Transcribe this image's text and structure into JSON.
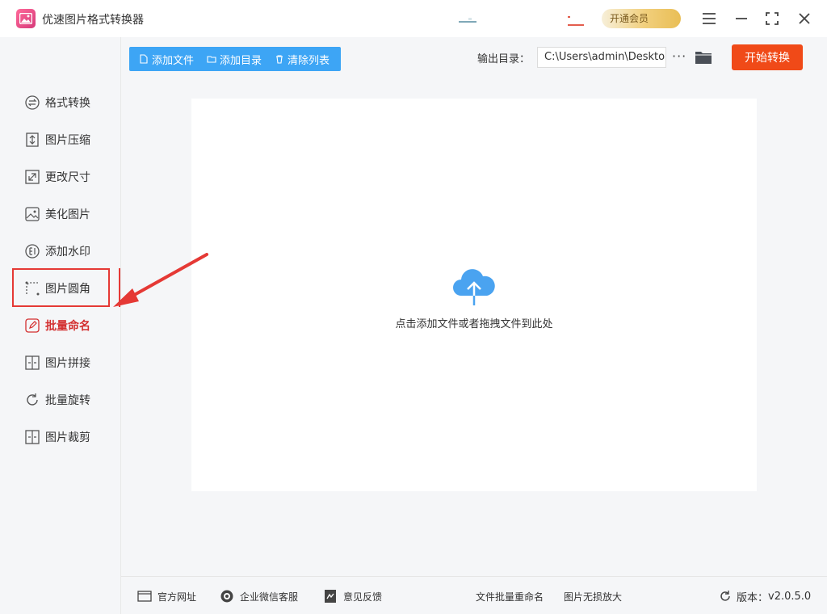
{
  "app": {
    "title": "优速图片格式转换器",
    "vip_label": "开通会员"
  },
  "sidebar": {
    "items": [
      {
        "label": "格式转换",
        "icon": "format-convert-icon"
      },
      {
        "label": "图片压缩",
        "icon": "compress-icon"
      },
      {
        "label": "更改尺寸",
        "icon": "resize-icon"
      },
      {
        "label": "美化图片",
        "icon": "beautify-icon"
      },
      {
        "label": "添加水印",
        "icon": "watermark-icon"
      },
      {
        "label": "图片圆角",
        "icon": "round-corner-icon"
      },
      {
        "label": "批量命名",
        "icon": "rename-icon",
        "active": true
      },
      {
        "label": "图片拼接",
        "icon": "stitch-icon"
      },
      {
        "label": "批量旋转",
        "icon": "rotate-icon"
      },
      {
        "label": "图片裁剪",
        "icon": "crop-icon"
      }
    ]
  },
  "toolbar": {
    "add_file": "添加文件",
    "add_folder": "添加目录",
    "clear_list": "清除列表",
    "output_label": "输出目录：",
    "output_path": "C:\\Users\\admin\\Desktop",
    "more": "···",
    "start": "开始转换"
  },
  "dropzone": {
    "text": "点击添加文件或者拖拽文件到此处"
  },
  "footer": {
    "website": "官方网址",
    "wechat": "企业微信客服",
    "feedback": "意见反馈",
    "rename_link": "文件批量重命名",
    "enlarge_link": "图片无损放大",
    "version_label": "版本：",
    "version": "v2.0.5.0"
  },
  "colors": {
    "accent_blue": "#3da5f5",
    "start_orange": "#f04a18",
    "active_red": "#e53935"
  }
}
